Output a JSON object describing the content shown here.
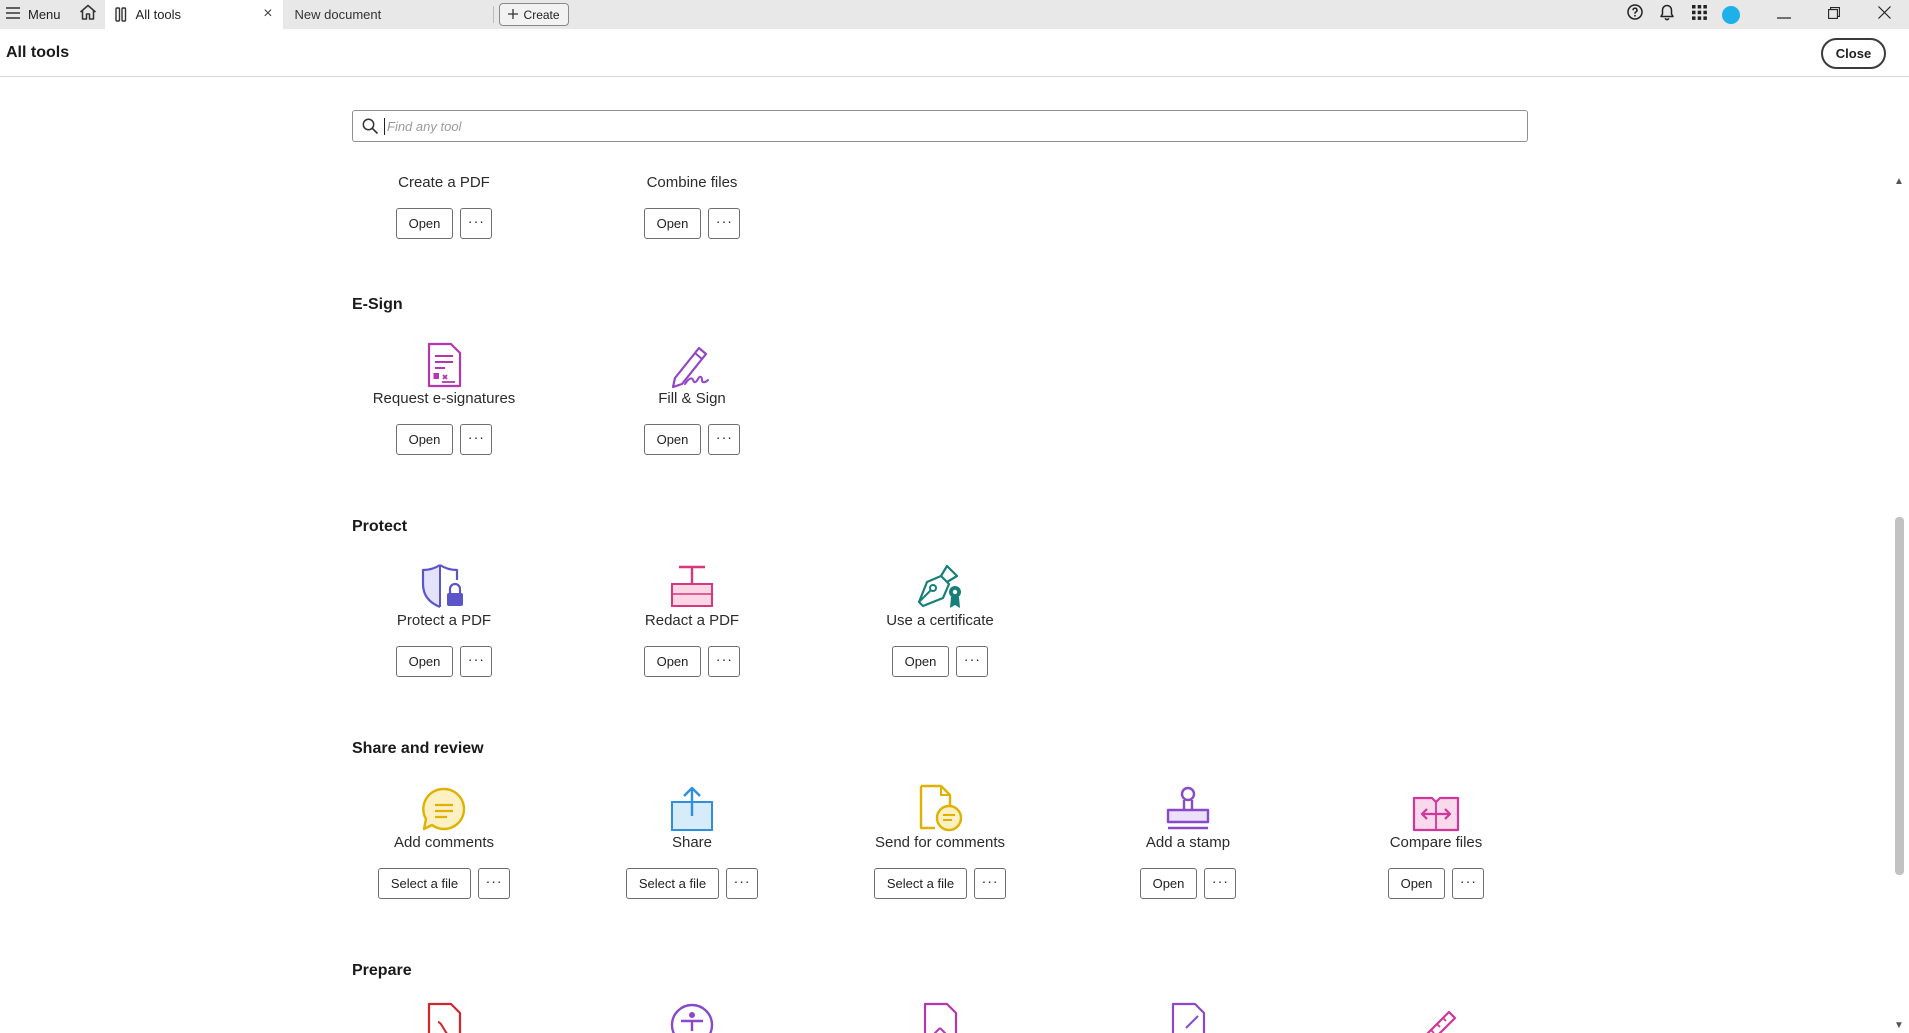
{
  "tabbar": {
    "menu_label": "Menu",
    "active_tab_label": "All tools",
    "inactive_tab_label": "New document",
    "create_label": "Create"
  },
  "header": {
    "title": "All tools",
    "close_label": "Close"
  },
  "search": {
    "placeholder": "Find any tool"
  },
  "sections": {
    "create": {
      "tools": [
        {
          "name": "Create a PDF",
          "action": "Open",
          "more": "···"
        },
        {
          "name": "Combine files",
          "action": "Open",
          "more": "···"
        }
      ]
    },
    "esign": {
      "title": "E-Sign",
      "tools": [
        {
          "name": "Request e-signatures",
          "action": "Open",
          "more": "···",
          "icon": "request-esignature-icon",
          "color": "#b536b1"
        },
        {
          "name": "Fill & Sign",
          "action": "Open",
          "more": "···",
          "icon": "fill-sign-icon",
          "color": "#9245c5"
        }
      ]
    },
    "protect": {
      "title": "Protect",
      "tools": [
        {
          "name": "Protect a PDF",
          "action": "Open",
          "more": "···",
          "icon": "shield-lock-icon",
          "color": "#5b55c9"
        },
        {
          "name": "Redact a PDF",
          "action": "Open",
          "more": "···",
          "icon": "redact-icon",
          "color": "#d7377f"
        },
        {
          "name": "Use a certificate",
          "action": "Open",
          "more": "···",
          "icon": "certificate-pen-icon",
          "color": "#177f7a"
        }
      ]
    },
    "share_review": {
      "title": "Share and review",
      "tools": [
        {
          "name": "Add comments",
          "action": "Select a file",
          "more": "···",
          "icon": "comment-icon",
          "color": "#e0b100"
        },
        {
          "name": "Share",
          "action": "Select a file",
          "more": "···",
          "icon": "share-upload-icon",
          "color": "#2f8fdd"
        },
        {
          "name": "Send for comments",
          "action": "Select a file",
          "more": "···",
          "icon": "send-for-comments-icon",
          "color": "#e0b100"
        },
        {
          "name": "Add a stamp",
          "action": "Open",
          "more": "···",
          "icon": "stamp-icon",
          "color": "#8a49c9"
        },
        {
          "name": "Compare files",
          "action": "Open",
          "more": "···",
          "icon": "compare-files-icon",
          "color": "#d1369a"
        }
      ]
    },
    "prepare": {
      "title": "Prepare"
    }
  }
}
